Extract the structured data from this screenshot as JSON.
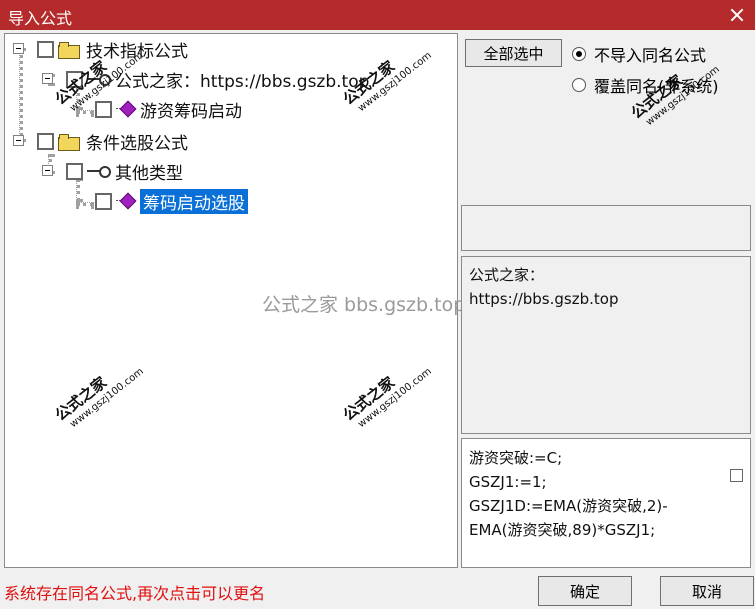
{
  "window": {
    "title": "导入公式"
  },
  "tree": {
    "nodes": [
      {
        "label": "技术指标公式"
      },
      {
        "label": "公式之家：https://bbs.gszb.top"
      },
      {
        "label": "游资筹码启动"
      },
      {
        "label": "条件选股公式"
      },
      {
        "label": "其他类型"
      },
      {
        "label": "筹码启动选股"
      }
    ]
  },
  "watermark": {
    "brand": "公式之家",
    "url": "www.gszj100.com",
    "center_text": "公式之家 bbs.gszb.top"
  },
  "options": {
    "select_all_label": "全部选中",
    "radio_no_import_label": "不导入同名公式",
    "radio_overwrite_label": "覆盖同名(非系统)"
  },
  "description": {
    "line1": "公式之家：",
    "line2": "https://bbs.gszb.top"
  },
  "code": {
    "lines": [
      "游资突破:=C;",
      "GSZJ1:=1;",
      "GSZJ1D:=EMA(游资突破,2)-",
      "EMA(游资突破,89)*GSZJ1;"
    ]
  },
  "status": {
    "message": "系统存在同名公式,再次点击可以更名"
  },
  "buttons": {
    "ok_label": "确定",
    "cancel_label": "取消"
  },
  "colors": {
    "titlebar": "#b52a2a",
    "selection": "#0a6fd6",
    "status_text": "#e01010"
  }
}
